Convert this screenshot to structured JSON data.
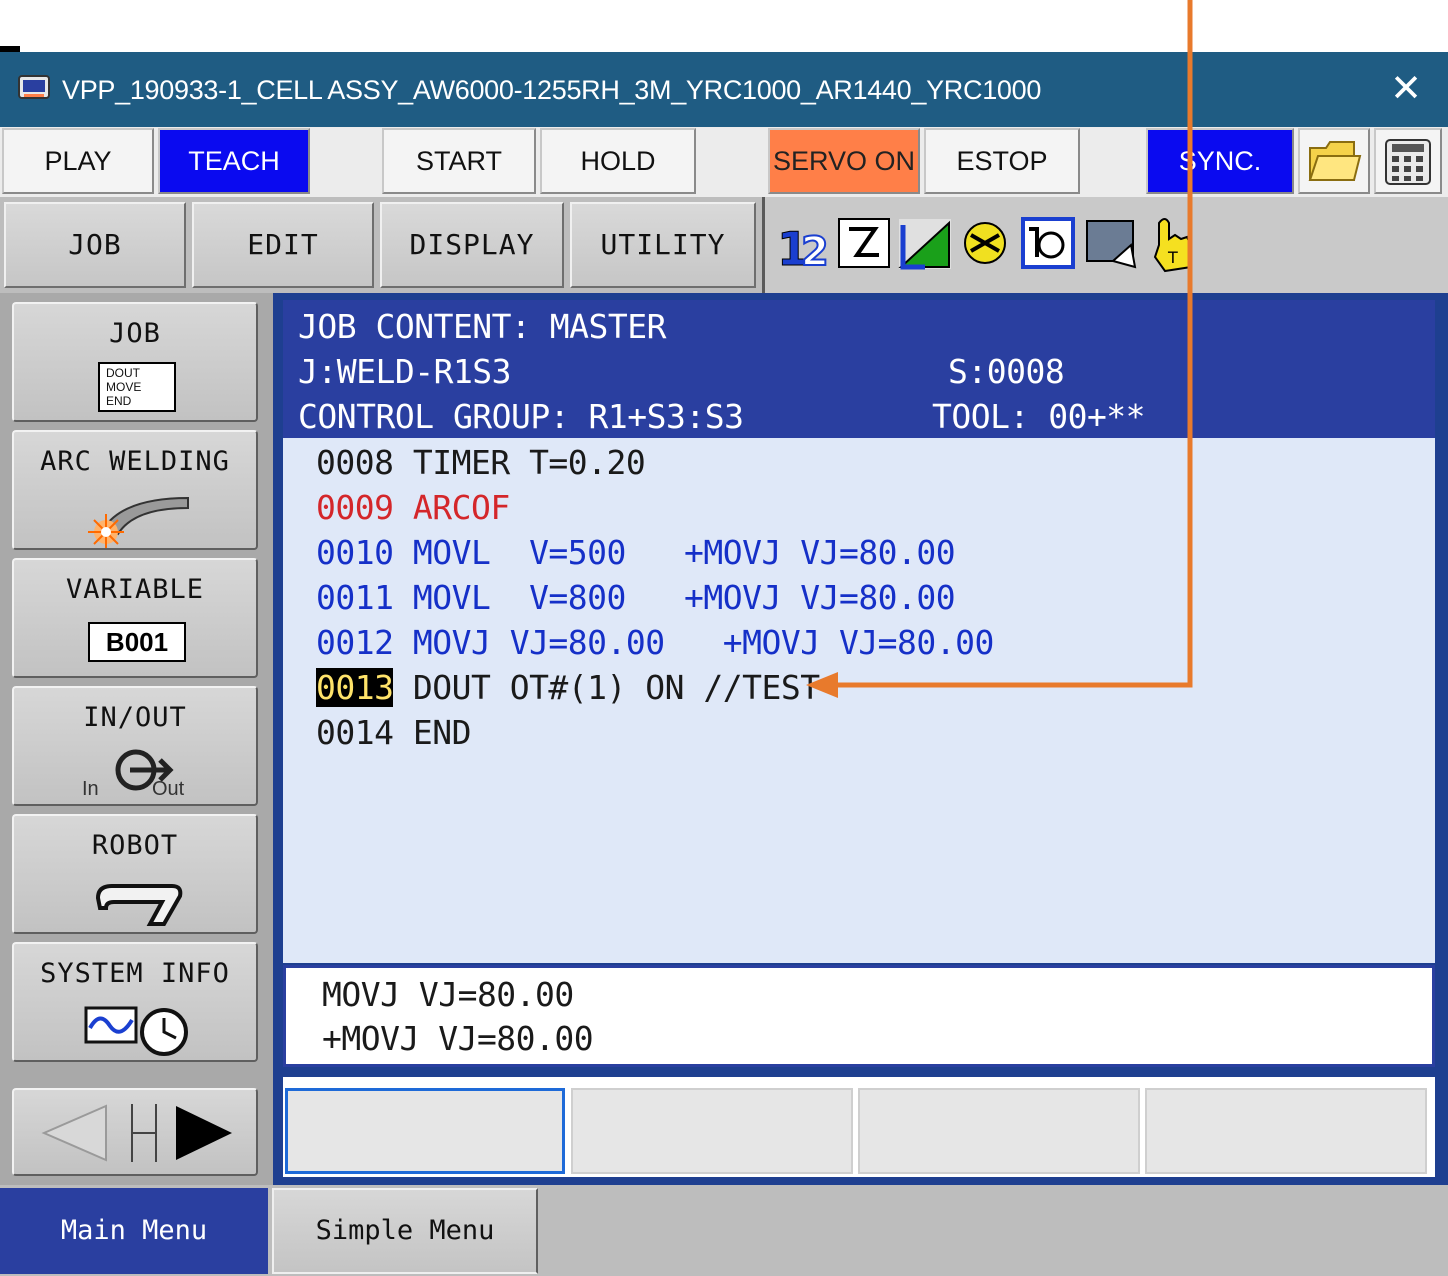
{
  "window": {
    "title": "VPP_190933-1_CELL ASSY_AW6000-1255RH_3M_YRC1000_AR1440_YRC1000",
    "close_icon": "close-icon",
    "app_icon": "pendant-icon"
  },
  "command_row": {
    "play": "PLAY",
    "teach": "TEACH",
    "start": "START",
    "hold": "HOLD",
    "servo_on": "SERVO ON",
    "estop": "ESTOP",
    "sync": "SYNC.",
    "folder_icon": "folder-icon",
    "keypad_icon": "keypad-icon"
  },
  "menu_row": {
    "job": "JOB",
    "edit": "EDIT",
    "display": "DISPLAY",
    "utility": "UTILITY",
    "status_icons": [
      "axis-icon",
      "edit-mode-icon",
      "speed-icon",
      "coordinate-icon",
      "tool-icon",
      "screen-icon",
      "hand-icon"
    ]
  },
  "left_menu": {
    "job": {
      "label": "JOB",
      "icon_lines": [
        "DOUT",
        "MOVE",
        "END"
      ]
    },
    "arc_welding": {
      "label": "ARC WELDING"
    },
    "variable": {
      "label": "VARIABLE",
      "value": "B001"
    },
    "in_out": {
      "label": "IN/OUT",
      "in": "In",
      "out": "Out"
    },
    "robot": {
      "label": "ROBOT"
    },
    "system_info": {
      "label": "SYSTEM INFO"
    }
  },
  "job_header": {
    "title": "JOB CONTENT: MASTER",
    "job": "J:WELD-R1S3",
    "step": "S:0008",
    "control_group": "CONTROL GROUP: R1+S3:S3",
    "tool": "TOOL: 00+**"
  },
  "job_lines": [
    {
      "num": "0008",
      "text": "TIMER T=0.20"
    },
    {
      "num": "0009",
      "text": "ARCOF"
    },
    {
      "num": "0010",
      "text": "MOVL  V=500   +MOVJ VJ=80.00"
    },
    {
      "num": "0011",
      "text": "MOVL  V=800   +MOVJ VJ=80.00"
    },
    {
      "num": "0012",
      "text": "MOVJ VJ=80.00   +MOVJ VJ=80.00"
    },
    {
      "num": "0013",
      "text": "DOUT OT#(1) ON //TEST"
    },
    {
      "num": "0014",
      "text": "END"
    }
  ],
  "input_buffer": {
    "line1": "MOVJ VJ=80.00",
    "line2": "+MOVJ VJ=80.00"
  },
  "bottom_tabs": {
    "main_menu": "Main Menu",
    "simple_menu": "Simple Menu"
  },
  "colors": {
    "title_bar": "#1f5c83",
    "teach_active": "#0a0af0",
    "servo_on": "#ff7f48",
    "header_bg": "#2a3fa0",
    "content_bg": "#dfe8f8",
    "alarm_line": "#d4262a",
    "move_line": "#1530c8",
    "annotation_arrow": "#e87a2c"
  }
}
